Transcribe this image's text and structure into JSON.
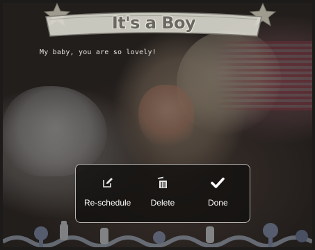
{
  "banner": {
    "title": "It's a Boy"
  },
  "photo": {
    "caption": "My baby, you are so lovely!"
  },
  "menu": {
    "items": [
      {
        "label": "Re-schedule",
        "icon": "edit-icon"
      },
      {
        "label": "Delete",
        "icon": "trash-icon"
      },
      {
        "label": "Done",
        "icon": "checkmark-icon"
      }
    ]
  },
  "colors": {
    "menu_background": "#121010",
    "menu_border": "#b9b6b2",
    "banner_text": "#6a6862",
    "checkmark": "#ffffff"
  }
}
